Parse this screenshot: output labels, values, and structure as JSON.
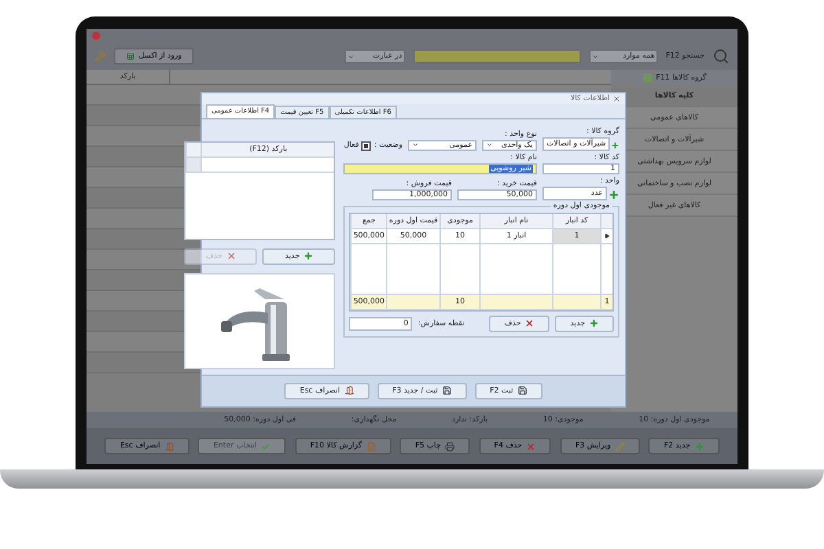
{
  "toolbar": {
    "search_label": "جستجو F12",
    "scope": "همه موارد",
    "match": "در عبارت",
    "excel_button": "ورود از اکسل"
  },
  "table": {
    "columns": [
      "بارکد"
    ]
  },
  "sidebar": {
    "title": "گروه کالاها F11",
    "items": [
      {
        "label": "کلیه کالاها",
        "selected": true
      },
      {
        "label": "کالاهای عمومی",
        "selected": false
      },
      {
        "label": "شیرآلات و اتصالات",
        "selected": false
      },
      {
        "label": "لوازم سرویس بهداشتی",
        "selected": false
      },
      {
        "label": "لوازم نصب و ساختمانی",
        "selected": false
      },
      {
        "label": "کالاهای غیر فعال",
        "selected": false
      }
    ]
  },
  "status_bar": [
    "موجودی اول دوره: 10",
    "موجودی: 10",
    "بارکد: ندارد",
    "محل نگهداری:",
    "فی اول دوره: 50,000"
  ],
  "actions": [
    {
      "label": "جدید F2",
      "kind": "add",
      "disabled": false
    },
    {
      "label": "ویرایش F3",
      "kind": "edit",
      "disabled": false
    },
    {
      "label": "حذف F4",
      "kind": "delete",
      "disabled": false
    },
    {
      "label": "چاپ F5",
      "kind": "print",
      "disabled": false
    },
    {
      "label": "گزارش کالا F10",
      "kind": "report",
      "disabled": false
    },
    {
      "label": "انتخاب Enter",
      "kind": "select",
      "disabled": true
    },
    {
      "label": "انصراف Esc",
      "kind": "cancel",
      "disabled": false
    }
  ],
  "dialog": {
    "title": "اطلاعات کالا",
    "tabs": [
      {
        "label": "اطلاعات تکمیلی F6",
        "selected": false
      },
      {
        "label": "تعیین قیمت F5",
        "selected": false
      },
      {
        "label": "اطلاعات عمومی F4",
        "selected": true
      }
    ],
    "group": {
      "label": "گروه کالا :",
      "value": "شیرآلات و اتصالات"
    },
    "unit_type": {
      "label": "نوع واحد :",
      "value": "یک واحدی"
    },
    "category": {
      "value": "عمومی"
    },
    "status": {
      "label": "وضعیت :",
      "text": "فعال",
      "checked": true
    },
    "code": {
      "label": "کد کالا :",
      "value": "1"
    },
    "name": {
      "label": "نام کالا :",
      "value": "شیر روشویی"
    },
    "unit": {
      "label": "واحد :",
      "value": "عدد"
    },
    "buy_price": {
      "label": "قیمت خرید :",
      "value": "50,000"
    },
    "sell_price": {
      "label": "قیمت فروش :",
      "value": "1,000,000"
    },
    "stock": {
      "title": "موجودی اول دوره",
      "columns": [
        "کد انبار",
        "نام انبار",
        "موجودی",
        "قیمت اول دوره",
        "جمع"
      ],
      "rows": [
        [
          "1",
          "انبار 1",
          "10",
          "50,000",
          "500,000"
        ]
      ],
      "totals": {
        "count": "1",
        "stock": "10",
        "sum": "500,000"
      },
      "buttons": [
        {
          "label": "جدید",
          "kind": "add",
          "disabled": false
        },
        {
          "label": "حذف",
          "kind": "delete",
          "disabled": false
        }
      ]
    },
    "reorder": {
      "label": "نقطه سفارش:",
      "value": "0"
    },
    "barcodes": {
      "column": "بارکد (F12)",
      "buttons": [
        {
          "label": "جدید",
          "kind": "add",
          "disabled": false
        },
        {
          "label": "حذف",
          "kind": "delete",
          "disabled": true
        }
      ]
    },
    "buttons": [
      {
        "label": "ثبت F2",
        "kind": "save"
      },
      {
        "label": "ثبت / جدید F3",
        "kind": "save_new"
      },
      {
        "label": "انصراف Esc",
        "kind": "cancel"
      }
    ]
  }
}
